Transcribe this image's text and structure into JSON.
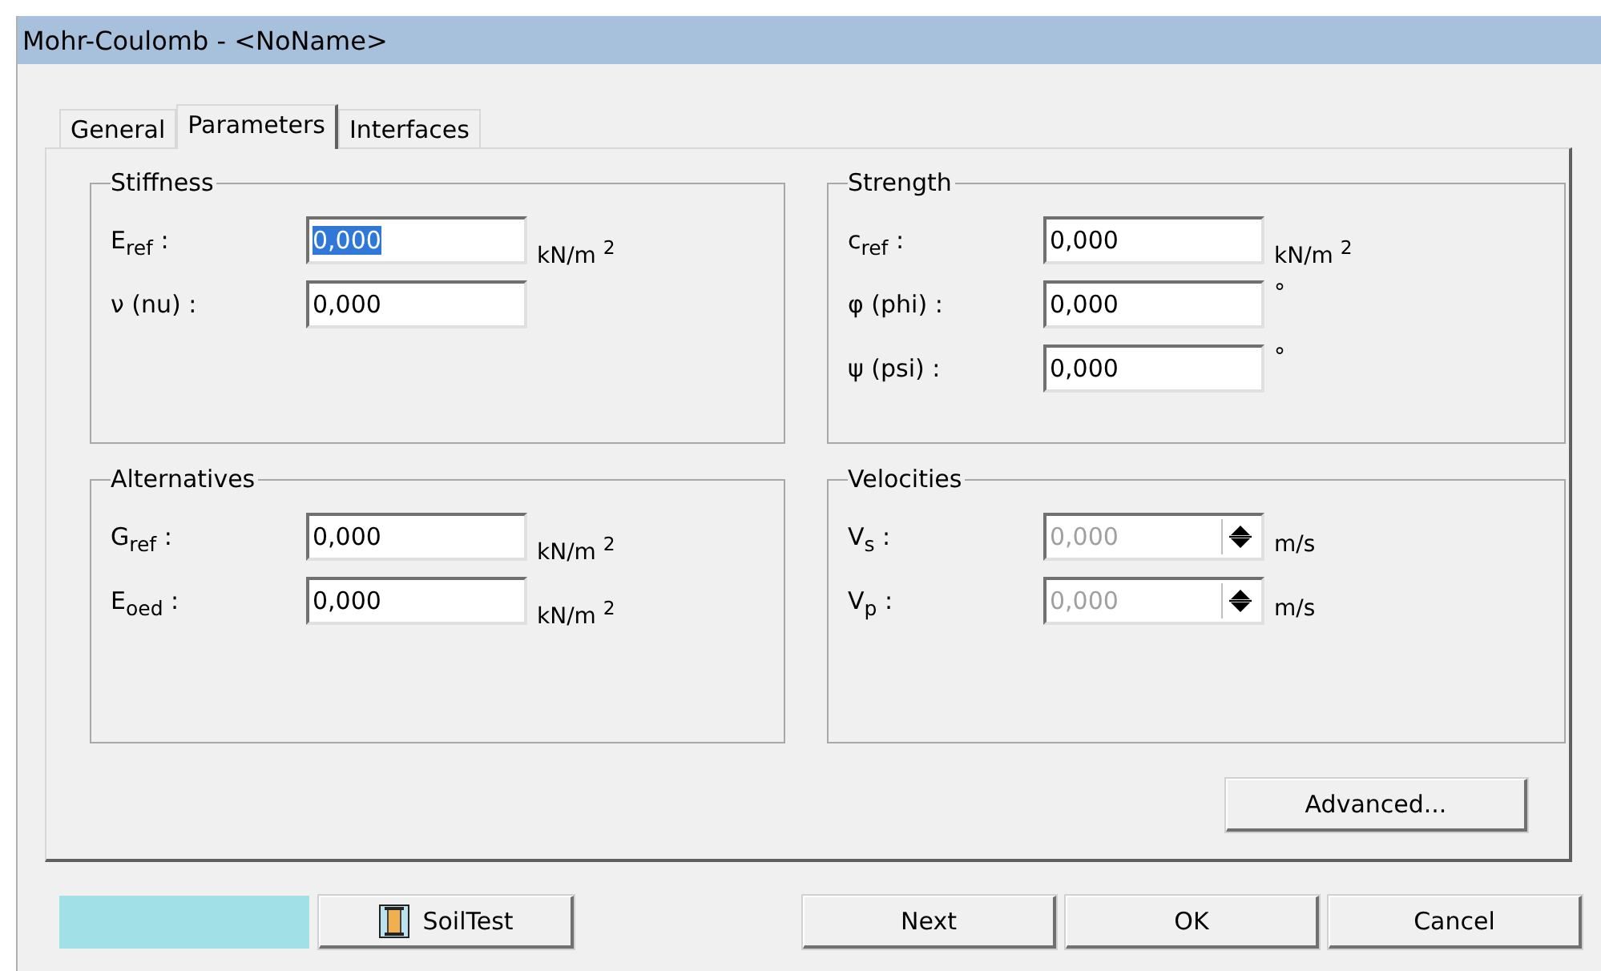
{
  "window": {
    "title": "Mohr-Coulomb - <NoName>"
  },
  "tabs": [
    {
      "label": "General",
      "selected": false
    },
    {
      "label": "Parameters",
      "selected": true
    },
    {
      "label": "Interfaces",
      "selected": false
    }
  ],
  "groups": [
    {
      "title": "Stiffness",
      "fields": [
        {
          "kind": "text",
          "label": "E$_{ref}$ :",
          "value": "0,000",
          "unit": "kN/m $^{2}$",
          "selected": true,
          "disabled": false
        },
        {
          "kind": "text",
          "label": "ν (nu) :",
          "value": "0,000",
          "selected": false,
          "disabled": false
        }
      ]
    },
    {
      "title": "Strength",
      "fields": [
        {
          "kind": "text",
          "label": "c$_{ref}$ :",
          "value": "0,000",
          "unit": "kN/m $^{2}$",
          "selected": false,
          "disabled": false
        },
        {
          "kind": "text",
          "label": "φ (phi) :",
          "value": "0,000",
          "unit": "°",
          "selected": false,
          "disabled": false
        },
        {
          "kind": "text",
          "label": "ψ (psi) :",
          "value": "0,000",
          "unit": "°",
          "selected": false,
          "disabled": false
        }
      ]
    },
    {
      "title": "Alternatives",
      "fields": [
        {
          "kind": "text",
          "label": "G$_{ref}$ :",
          "value": "0,000",
          "unit": "kN/m $^{2}$",
          "selected": false,
          "disabled": false
        },
        {
          "kind": "text",
          "label": "E$_{oed}$ :",
          "value": "0,000",
          "unit": "kN/m $^{2}$",
          "selected": false,
          "disabled": false
        }
      ]
    },
    {
      "title": "Velocities",
      "fields": [
        {
          "kind": "spin",
          "label": "V$_{s}$ :",
          "value": "0,000",
          "unit": "m/s",
          "selected": false,
          "disabled": true
        },
        {
          "kind": "spin",
          "label": "V$_{p}$ :",
          "value": "0,000",
          "unit": "m/s",
          "selected": false,
          "disabled": true
        }
      ]
    }
  ],
  "advanced_button": "Advanced...",
  "color_swatch": {
    "color": "#a0e0e6"
  },
  "soiltest_button": "SoilTest",
  "buttons": [
    "Next",
    "OK",
    "Cancel"
  ]
}
